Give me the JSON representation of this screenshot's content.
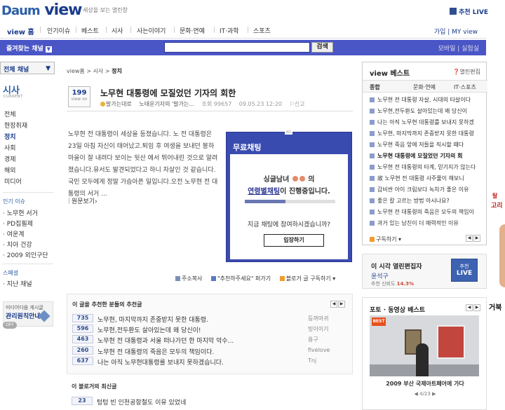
{
  "header": {
    "logo_daum": "Daum",
    "logo_view": "view",
    "tagline": "세상을 보는 열린창",
    "live_link": "추천 LIVE"
  },
  "nav": {
    "items": [
      "view 홈",
      "인기이슈",
      "베스트",
      "시사",
      "사는이야기",
      "문화·연예",
      "IT·과학",
      "스포츠"
    ],
    "right": "가입 | MY view"
  },
  "search": {
    "fav_channel": "즐겨찾는 채널",
    "placeholder": "",
    "button": "검색",
    "right": "모바일 | 실험실"
  },
  "sidebar": {
    "channel_select": "전체 채널",
    "category_title": "시사",
    "category_sub": "CURRENT",
    "menu": [
      "전체",
      "현장취재",
      "정치",
      "사회",
      "경제",
      "해외",
      "미디어"
    ],
    "active_index": 2,
    "issue_head": "인기 이슈",
    "issues": [
      "· 노무현 서거",
      "· PD집필제",
      "· 여운계",
      "· 치아 건강",
      "· 2009 외인구단"
    ],
    "special_head": "스페셜",
    "specials": [
      "· 지난 채널"
    ],
    "admin_line1": "미디어다음 게시글",
    "admin_line2": "관리원칙안내",
    "toggle": "OFF"
  },
  "breadcrumb": {
    "path": "view홈 > 시사 > ",
    "current": "정치"
  },
  "post": {
    "votes": "199",
    "votes_label": "view on",
    "title": "노무현 대통령에 모질었던 기자의 회한",
    "author": "발가는대로",
    "blog": "노태운기자의 '발가는...",
    "views": "조회 99657",
    "date": "09.05.23 12:20",
    "report": "신고",
    "excerpt": "노무현 전 대통령이 세상을 등졌습니다. 노 전 대통령은 23일 아침 자신이 태어났고.퇴임 후 여생을 보내던 봉하마을이 잘 내려다 보이는 뒷산 에서 뛰어내린 것으로 알려졌습니다.유서도 발견되었다고 하니 자살인 것 같습니다. 국민 모두에게 정말 가슴아픈 일입니다.오전 노무현 전 대통령의 서거 ...",
    "read_more": "원문보기"
  },
  "chat_ad": {
    "ad_label": "AD",
    "title": "무료채팅",
    "line1_prefix": "싱글남녀",
    "line1_suffix": "의",
    "line2_link": "연령별채팅",
    "line2_suffix": "이 진행중입니다.",
    "progress": 0.45,
    "question": "지금 채팅에 참여하시겠습니까?",
    "button": "입장하기"
  },
  "actions": {
    "address": "주소복사",
    "recommend": "\"추천하주세요\" 퍼가기",
    "subscribe": "블로거 글 구독하기"
  },
  "recommenders": {
    "head": "이 글을 추천한 분들의 추천글",
    "rows": [
      {
        "count": "735",
        "title": "노무현, 마지막까지 존중받지 못한 대통령.",
        "user": "등까마귀"
      },
      {
        "count": "596",
        "title": "노무현,전두환도 살아있는데 왜 당신이!",
        "user": "빙이이기"
      },
      {
        "count": "463",
        "title": "노무현 전 대통령과 서울 떠나가던 한 마지막 악수...",
        "user": "용구"
      },
      {
        "count": "260",
        "title": "노무현 전 대통령의 죽음은 모두의 책임이다.",
        "user": "fivelove"
      },
      {
        "count": "637",
        "title": "나는 아직 노무현대통령를 보내지 못하겠습니다.",
        "user": "Tnj"
      }
    ]
  },
  "latest": {
    "head": "이 블로거의 최신글",
    "rows": [
      {
        "count": "23",
        "title": "텅텅 빈 인천공항철도 이유 있었네"
      }
    ]
  },
  "best": {
    "head": "view 베스트",
    "open_edit": "열린편집",
    "tabs": [
      "종합",
      "문화·연예",
      "IT·스포츠"
    ],
    "items": [
      "노무현 전 대통령 자살, 시대의 타살이다",
      "노무현,전두환도 살아있는데 왜 당신이",
      "나는 아직 노무현 대통령를 보내지 못하겠",
      "노무현, 마지막까지 존중받지 못한 대통령",
      "노무현 죽음 앞에 저들을 직시할 때다",
      "노무현 대통령에 모질었던 기자의 회",
      "노무현 전 대통령의 타계, 믿기지가 않는다",
      "故 노무현 전 대통령 사주풀이 해보니",
      "갑비싼 아이 크림보다 녹차가 좋은 이유",
      "좋은 칼 고르는 방법 아시나요?",
      "노무현 전 대통령의 죽음은 모두의 책임이",
      "과거 있는 남친이 더 매력적인 이유"
    ],
    "highlight_index": 5,
    "subscribe": "구독하기"
  },
  "live": {
    "line1": "이 시각 열린편집자",
    "name": "윤석구",
    "rate_label": "추천 신뢰도",
    "rate": "14.3%",
    "badge_top": "추천",
    "badge_bottom": "LIVE"
  },
  "photo": {
    "head": "포토 · 동영상 베스트",
    "badge": "BEST",
    "caption": "2009 부산 국제아트페어에 가다",
    "pager": "4/23"
  },
  "edge_ads": {
    "t1": "탈",
    "t2": "고리",
    "t3": "거북"
  },
  "colors": {
    "brand": "#1a3c8c",
    "search_bar": "#4a56c6",
    "chat_bg": "#3a4bb0"
  }
}
